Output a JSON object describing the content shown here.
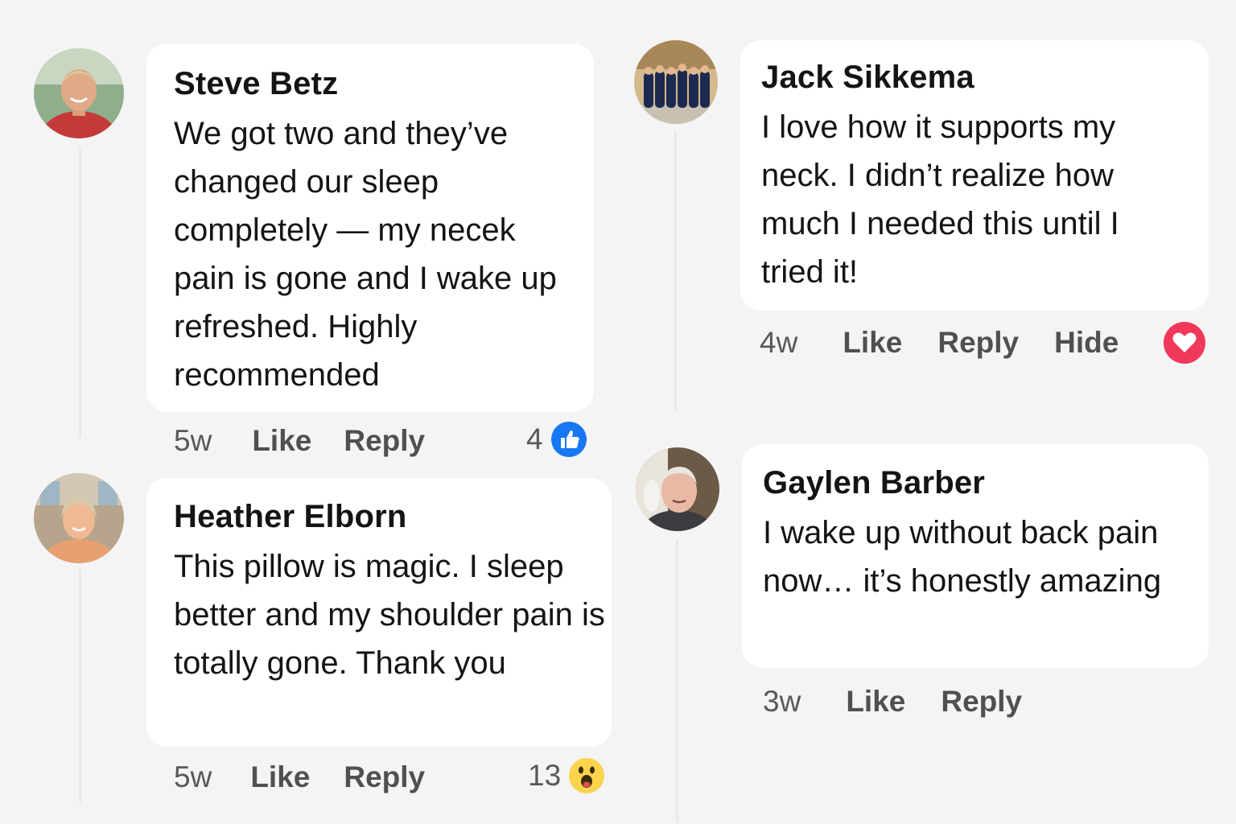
{
  "comments": [
    {
      "author": "Steve Betz",
      "text": "We got two and they’ve changed our sleep completely — my necek pain is gone and I wake up refreshed. Highly recommended",
      "time": "5w",
      "like_label": "Like",
      "reply_label": "Reply",
      "reaction_count": "4",
      "reaction_icon": "thumbs-up-icon"
    },
    {
      "author": "Heather Elborn",
      "text": "This pillow is magic. I sleep better and my shoulder pain is totally gone. Thank you",
      "time": "5w",
      "like_label": "Like",
      "reply_label": "Reply",
      "reaction_count": "13",
      "reaction_icon": "wow-face-icon"
    },
    {
      "author": "Jack Sikkema",
      "text": "I love how it supports my neck. I didn’t realize how much I needed this until I tried it!",
      "time": "4w",
      "like_label": "Like",
      "reply_label": "Reply",
      "hide_label": "Hide",
      "reaction_icon": "heart-icon"
    },
    {
      "author": "Gaylen Barber",
      "text": "I wake up without back pain now… it’s honestly amazing",
      "time": "3w",
      "like_label": "Like",
      "reply_label": "Reply"
    }
  ],
  "colors": {
    "like_blue": "#1877f2",
    "love_red": "#f0385a",
    "wow_yellow": "#fcd34d",
    "bubble": "#ffffff",
    "background": "#f4f4f5"
  }
}
